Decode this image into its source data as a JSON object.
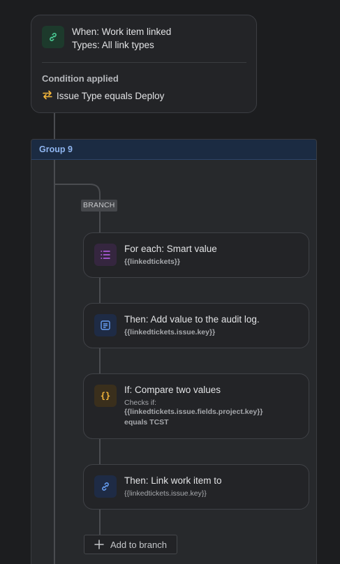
{
  "trigger": {
    "title": "When: Work item linked",
    "types": "Types: All link types",
    "condition_heading": "Condition applied",
    "condition_text": "Issue Type equals Deploy"
  },
  "group": {
    "title": "Group 9",
    "branch_tag": "BRANCH",
    "steps": [
      {
        "title": "For each: Smart value",
        "sub": "{{linkedtickets}}",
        "icon": "list-icon"
      },
      {
        "title": "Then: Add value to the audit log.",
        "sub": "{{linkedtickets.issue.key}}",
        "icon": "log-icon"
      },
      {
        "title": "If: Compare two values",
        "sub_label": "Checks if:",
        "sub_expr": "{{linkedtickets.issue.fields.project.key}}",
        "sub_cond": "equals TCST",
        "icon": "braces-icon"
      },
      {
        "title": "Then: Link work item to",
        "sub": "{{linkedtickets.issue.key}}",
        "icon": "link-icon"
      }
    ],
    "add_label": "Add to branch"
  },
  "colors": {
    "background": "#1c1d1f",
    "card": "#232427",
    "group_header": "#1b2b42",
    "group_title": "#8fb5ef",
    "trigger_icon": "#4bce97",
    "condition_icon": "#f5b73b",
    "list_icon": "#bf63f3",
    "log_icon": "#669df1",
    "braces_icon": "#f5b73b",
    "link_icon": "#669df1"
  }
}
